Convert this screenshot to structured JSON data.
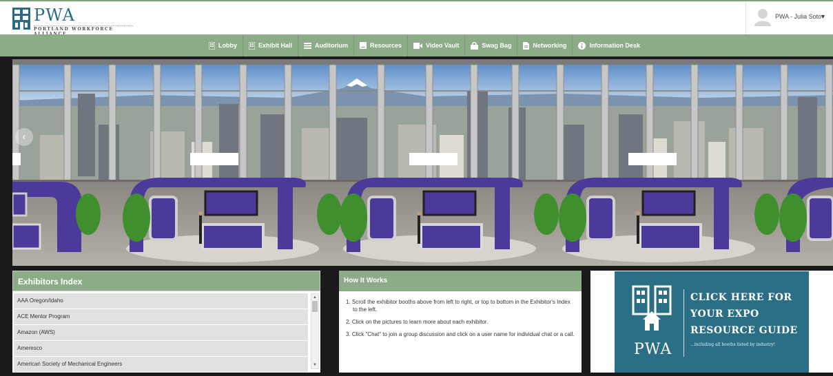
{
  "header": {
    "logo": {
      "title": "PWA",
      "subtitle": "PORTLAND WORKFORCE ALLIANCE"
    },
    "user": {
      "name": "PWA - Julia Soto",
      "caret": "▼"
    }
  },
  "nav": {
    "items": [
      {
        "label": "Lobby",
        "icon": "building-icon"
      },
      {
        "label": "Exhibit Hall",
        "icon": "building-icon"
      },
      {
        "label": "Auditorium",
        "icon": "list-icon"
      },
      {
        "label": "Resources",
        "icon": "book-icon"
      },
      {
        "label": "Video Vault",
        "icon": "video-icon"
      },
      {
        "label": "Swag Bag",
        "icon": "bag-icon"
      },
      {
        "label": "Networking",
        "icon": "file-icon"
      },
      {
        "label": "Information Desk",
        "icon": "info-icon"
      }
    ]
  },
  "hall": {
    "prev_arrow": "‹"
  },
  "exhibitors": {
    "title": "Exhibitors Index",
    "items": [
      "AAA Oregon/Idaho",
      "ACE Mentor Program",
      "Amazon (AWS)",
      "Ameresco",
      "American Society of Mechanical Engineers"
    ],
    "scroll_up": "▲",
    "scroll_down": "▼"
  },
  "how_it_works": {
    "title": "How It Works",
    "steps": [
      "1. Scroll the exhibitor booths above from left to right, or top to bottom in the Exhibitor's Index to the left.",
      "2. Click on the pictures to learn more about each exhibitor.",
      "3. Click \"Chat\" to join a group discussion and click on a user name for individual chat or a call."
    ]
  },
  "promo": {
    "lines": [
      "CLICK HERE FOR",
      "YOUR EXPO",
      "RESOURCE GUIDE"
    ],
    "subtitle": "...including all booths listed by industry!",
    "logo": "PWA"
  },
  "colors": {
    "accent_green": "#8cac87",
    "brand_teal": "#2a6f85",
    "booth_purple": "#4b3a9a"
  }
}
